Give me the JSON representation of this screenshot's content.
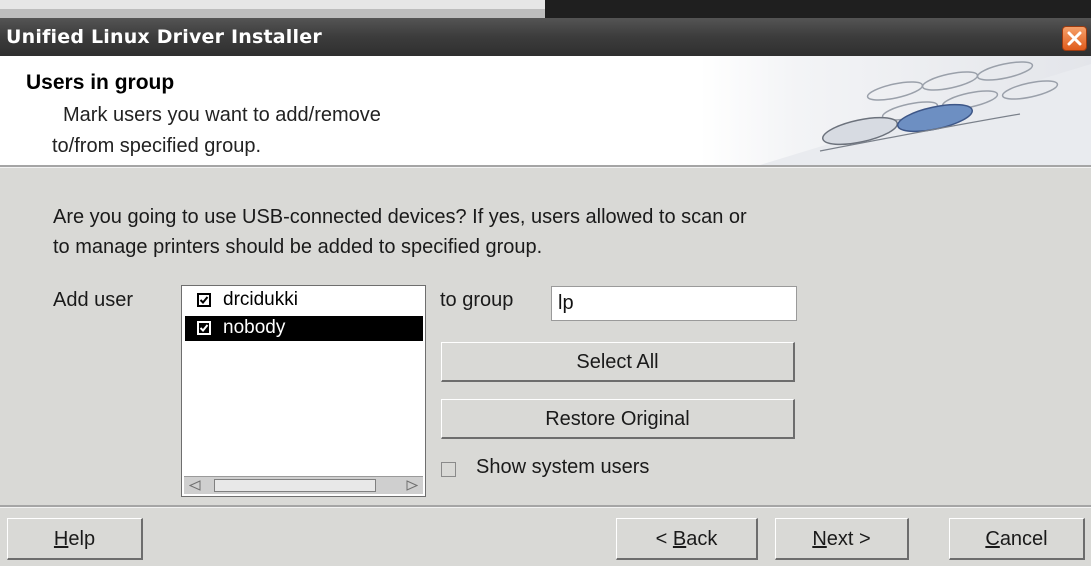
{
  "window": {
    "title": "Unified Linux Driver Installer"
  },
  "header": {
    "title": "Users in group",
    "subtitle_line1": "Mark users you want to add/remove",
    "subtitle_line2": "to/from specified group."
  },
  "body": {
    "question_line1": "Are you going to use USB-connected devices? If yes, users allowed to scan or",
    "question_line2": "to manage printers should be added to specified group.",
    "add_user_label": "Add user",
    "to_group_label": "to group",
    "group_value": "lp",
    "users": [
      {
        "name": "drcidukki",
        "checked": true,
        "selected": false
      },
      {
        "name": "nobody",
        "checked": true,
        "selected": true
      }
    ],
    "select_all_label": "Select All",
    "restore_original_label": "Restore Original",
    "show_system_users_label": "Show system users",
    "show_system_users_checked": false
  },
  "footer": {
    "help_label": "Help",
    "back_label": "< Back",
    "next_label": "Next >",
    "cancel_label": "Cancel"
  },
  "icons": {
    "close": "close-icon",
    "scroll_left": "arrow-left-icon",
    "scroll_right": "arrow-right-icon",
    "checkmark": "checkmark-icon"
  },
  "colors": {
    "titlebar": "#3c3c3c",
    "close_button": "#e05b1c",
    "dialog_bg": "#d9d9d6",
    "selection": "#000000"
  }
}
